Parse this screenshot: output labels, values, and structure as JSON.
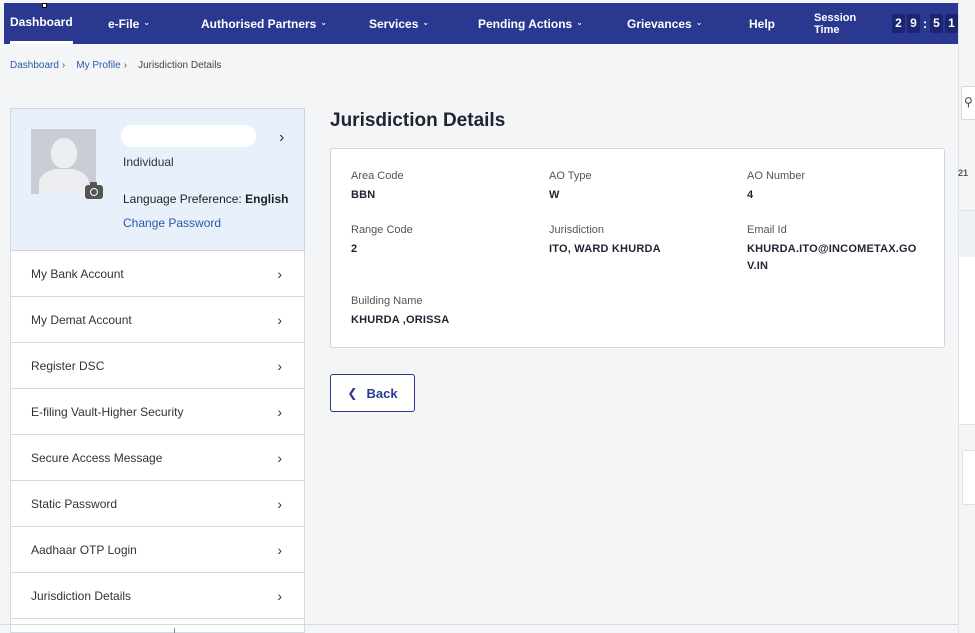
{
  "nav": {
    "items": [
      {
        "label": "Dashboard",
        "caret": false,
        "active": true
      },
      {
        "label": "e-File",
        "caret": true
      },
      {
        "label": "Authorised Partners",
        "caret": true
      },
      {
        "label": "Services",
        "caret": true
      },
      {
        "label": "Pending Actions",
        "caret": true
      },
      {
        "label": "Grievances",
        "caret": true
      },
      {
        "label": "Help",
        "caret": false
      }
    ],
    "session_label": "Session Time",
    "session_digits": [
      "2",
      "9",
      "5",
      "1"
    ]
  },
  "breadcrumb": {
    "items": [
      "Dashboard",
      "My Profile"
    ],
    "current": "Jurisdiction Details"
  },
  "profile": {
    "type": "Individual",
    "language_label": "Language Preference:",
    "language_value": "English",
    "change_password": "Change Password"
  },
  "menu": {
    "items": [
      "My Bank Account",
      "My Demat Account",
      "Register DSC",
      "E-filing Vault-Higher Security",
      "Secure Access Message",
      "Static Password",
      "Aadhaar OTP Login",
      "Jurisdiction Details"
    ]
  },
  "main": {
    "title": "Jurisdiction Details",
    "fields": {
      "area_code": {
        "label": "Area Code",
        "value": "BBN"
      },
      "ao_type": {
        "label": "AO Type",
        "value": "W"
      },
      "ao_number": {
        "label": "AO Number",
        "value": "4"
      },
      "range_code": {
        "label": "Range Code",
        "value": "2"
      },
      "jurisdiction": {
        "label": "Jurisdiction",
        "value": "ITO, WARD KHURDA"
      },
      "email_id": {
        "label": "Email Id",
        "value_line1": "KHURDA.ITO@INCOMETAX.GO",
        "value_line2": "V.IN"
      },
      "building_name": {
        "label": "Building Name",
        "value": "KHURDA ,ORISSA"
      }
    },
    "back_label": "Back"
  },
  "right_edge": {
    "fragment": "21",
    "search_icon": "search-icon"
  }
}
